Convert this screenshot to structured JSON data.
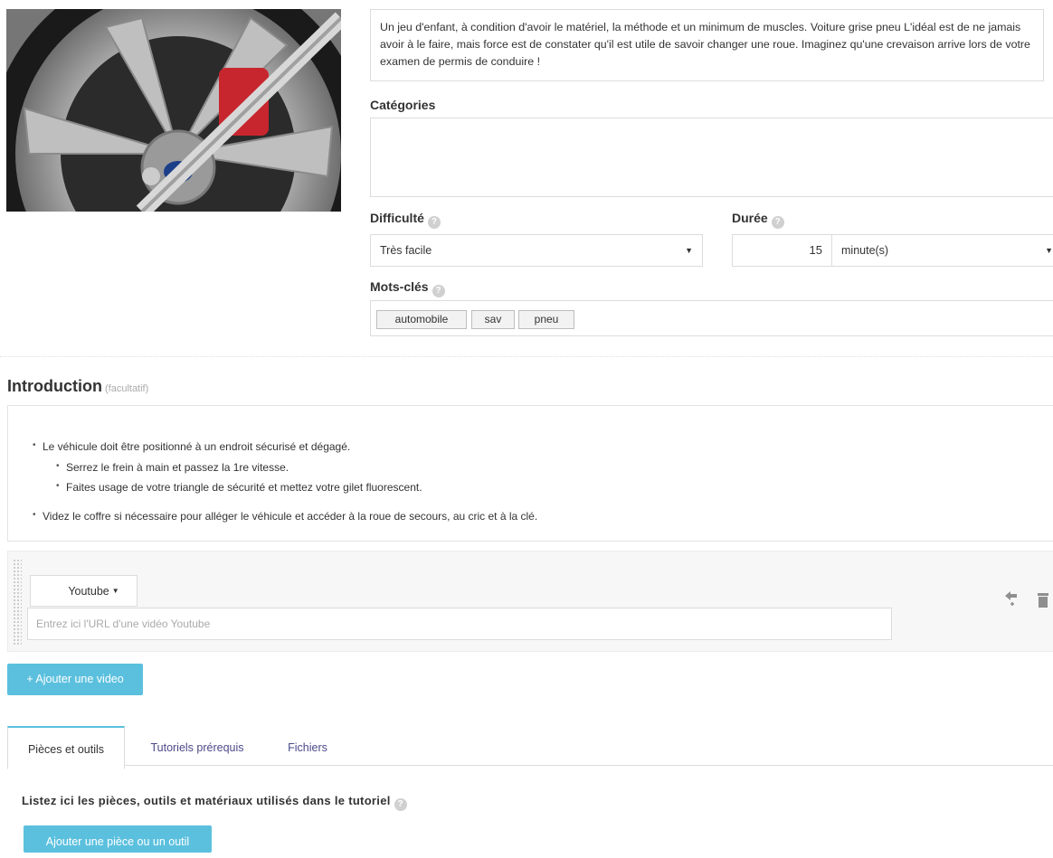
{
  "description": "Un jeu d'enfant, à condition d'avoir le matériel, la méthode et un minimum de muscles. Voiture grise pneu L'idéal est de ne jamais avoir à le faire, mais force est de constater qu'il est utile de savoir changer une roue. Imaginez qu'une crevaison arrive lors de votre examen de permis de conduire !",
  "categories": {
    "label": "Catégories"
  },
  "difficulty": {
    "label": "Difficulté",
    "value": "Très facile"
  },
  "duration": {
    "label": "Durée",
    "value": "15",
    "unit": "minute(s)"
  },
  "keywords": {
    "label": "Mots-clés",
    "tags": [
      "automobile",
      "sav",
      "pneu"
    ]
  },
  "intro": {
    "title": "Introduction",
    "optional": "(facultatif)",
    "items": [
      "Le véhicule doit être positionné à un endroit sécurisé et dégagé.",
      "Serrez le frein à main et passez la 1re vitesse.",
      "Faites usage de votre triangle de sécurité et mettez votre gilet fluorescent.",
      "Videz le coffre si nécessaire pour alléger le véhicule et accéder à la roue de secours, au cric et à la clé."
    ]
  },
  "video": {
    "provider": "Youtube",
    "url_placeholder": "Entrez ici l'URL d'une vidéo Youtube",
    "add_label": "+ Ajouter une video"
  },
  "tabs": [
    "Pièces et outils",
    "Tutoriels prérequis",
    "Fichiers"
  ],
  "parts": {
    "heading": "Listez ici les pièces, outils et matériaux utilisés dans le tutoriel",
    "add_label": "Ajouter une pièce ou un outil"
  },
  "colors": {
    "accent": "#5bc0de",
    "tab_link": "#4a4a8a"
  }
}
